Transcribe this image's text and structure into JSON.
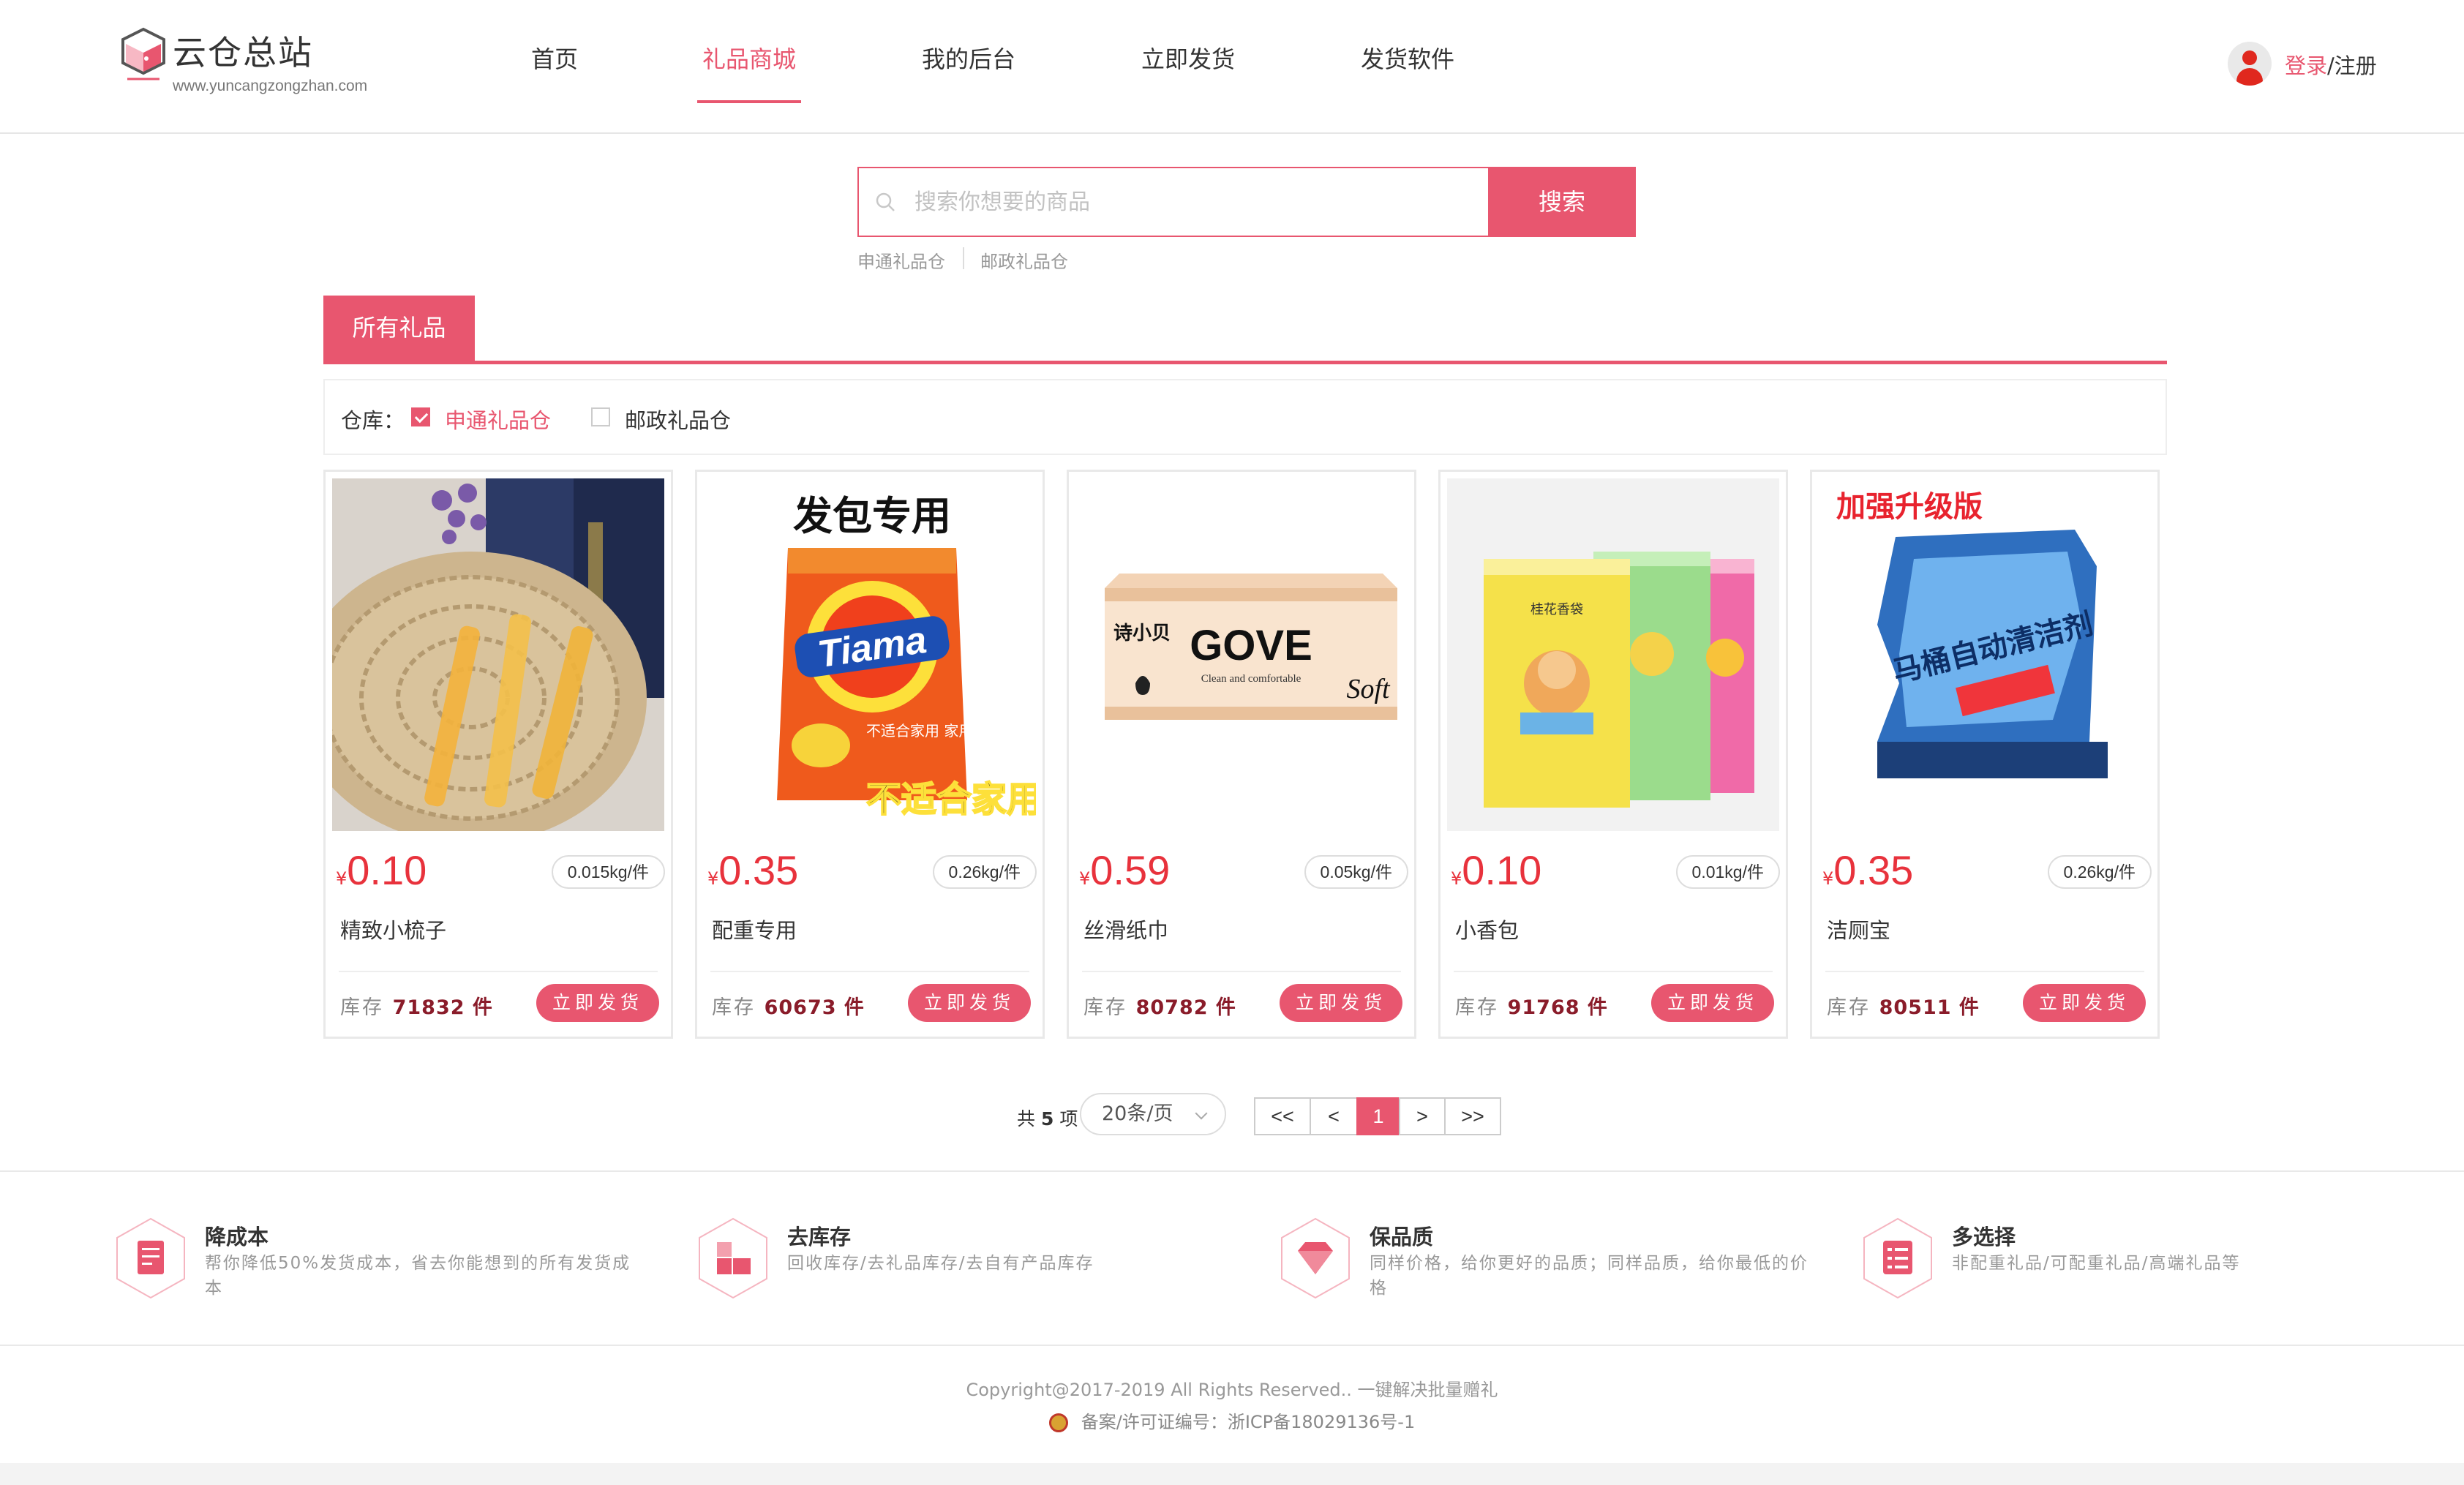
{
  "brand": {
    "title": "云仓总站",
    "url": "www.yuncangzongzhan.com"
  },
  "nav": {
    "items": [
      {
        "label": "首页",
        "active": false
      },
      {
        "label": "礼品商城",
        "active": true
      },
      {
        "label": "我的后台",
        "active": false
      },
      {
        "label": "立即发货",
        "active": false
      },
      {
        "label": "发货软件",
        "active": false
      }
    ]
  },
  "user": {
    "login": "登录",
    "sep_register": "/注册"
  },
  "search": {
    "placeholder": "搜索你想要的商品",
    "button": "搜索",
    "tags": [
      "申通礼品仓",
      "邮政礼品仓"
    ]
  },
  "tab": {
    "label": "所有礼品"
  },
  "filter": {
    "label": "仓库：",
    "options": [
      {
        "label": "申通礼品仓",
        "checked": true
      },
      {
        "label": "邮政礼品仓",
        "checked": false
      }
    ]
  },
  "products": [
    {
      "currency": "¥",
      "price": "0.10",
      "weight": "0.015kg/件",
      "name": "精致小梳子",
      "stock_label": "库存",
      "stock": "71832 件",
      "button": "立即发货"
    },
    {
      "currency": "¥",
      "price": "0.35",
      "weight": "0.26kg/件",
      "name": "配重专用",
      "stock_label": "库存",
      "stock": "60673 件",
      "button": "立即发货",
      "image_text": {
        "top": "发包专用",
        "brand": "Tiama",
        "warning": "不适合家用 家用勿拍",
        "bottom": "不适合家用"
      }
    },
    {
      "currency": "¥",
      "price": "0.59",
      "weight": "0.05kg/件",
      "name": "丝滑纸巾",
      "stock_label": "库存",
      "stock": "80782 件",
      "button": "立即发货",
      "image_text": {
        "left": "诗小贝",
        "brand": "GOVE",
        "sub": "Clean and comfortable",
        "right": "Soft"
      }
    },
    {
      "currency": "¥",
      "price": "0.10",
      "weight": "0.01kg/件",
      "name": "小香包",
      "stock_label": "库存",
      "stock": "91768 件",
      "button": "立即发货",
      "image_text": {
        "label": "桂花香袋"
      }
    },
    {
      "currency": "¥",
      "price": "0.35",
      "weight": "0.26kg/件",
      "name": "洁厕宝",
      "stock_label": "库存",
      "stock": "80511 件",
      "button": "立即发货",
      "image_text": {
        "top": "加强升级版",
        "pack": "马桶自动清洁剂"
      }
    }
  ],
  "pagination": {
    "total_prefix": "共",
    "total": "5",
    "total_suffix": "项",
    "page_size": "20条/页",
    "first": "<<",
    "prev": "<",
    "current": "1",
    "next": ">",
    "last": ">>"
  },
  "features": [
    {
      "title": "降成本",
      "desc": "帮你降低50%发货成本，省去你能想到的所有发货成本",
      "icon": "document-icon"
    },
    {
      "title": "去库存",
      "desc": "回收库存/去礼品库存/去自有产品库存",
      "icon": "boxes-icon"
    },
    {
      "title": "保品质",
      "desc": "同样价格，给你更好的品质；同样品质，给你最低的价格",
      "icon": "diamond-icon"
    },
    {
      "title": "多选择",
      "desc": "非配重礼品/可配重礼品/高端礼品等",
      "icon": "checklist-icon"
    }
  ],
  "footer": {
    "copyright": "Copyright@2017-2019 All Rights Reserved.. 一键解决批量赠礼",
    "beian": "备案/许可证编号：浙ICP备18029136号-1"
  },
  "colors": {
    "accent": "#e8566f",
    "price": "#e8323c",
    "stock": "#8a1c2a"
  }
}
